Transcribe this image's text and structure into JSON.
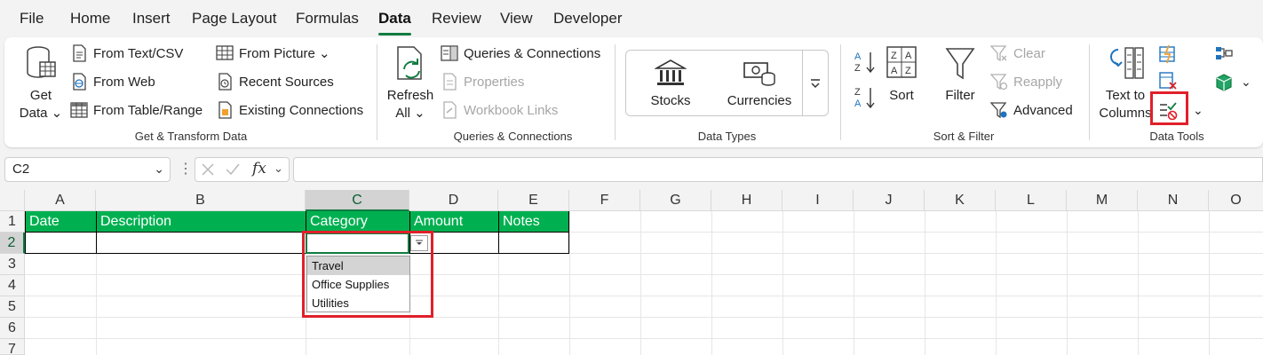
{
  "menu": {
    "tabs": [
      "File",
      "Home",
      "Insert",
      "Page Layout",
      "Formulas",
      "Data",
      "Review",
      "View",
      "Developer"
    ],
    "active": "Data"
  },
  "ribbon": {
    "get_transform": {
      "get_data_line1": "Get",
      "get_data_line2": "Data",
      "from_text_csv": "From Text/CSV",
      "from_web": "From Web",
      "from_table_range": "From Table/Range",
      "from_picture": "From Picture",
      "recent_sources": "Recent Sources",
      "existing_connections": "Existing Connections",
      "label": "Get & Transform Data"
    },
    "queries": {
      "refresh_line1": "Refresh",
      "refresh_line2": "All",
      "queries_connections": "Queries & Connections",
      "properties": "Properties",
      "workbook_links": "Workbook Links",
      "label": "Queries & Connections"
    },
    "data_types": {
      "stocks": "Stocks",
      "currencies": "Currencies",
      "label": "Data Types"
    },
    "sort_filter": {
      "sort": "Sort",
      "filter": "Filter",
      "clear": "Clear",
      "reapply": "Reapply",
      "advanced": "Advanced",
      "label": "Sort & Filter"
    },
    "data_tools": {
      "text_to_line1": "Text to",
      "text_to_line2": "Columns",
      "label": "Data Tools"
    }
  },
  "formula_bar": {
    "name_box": "C2",
    "fx": "fx",
    "formula": ""
  },
  "grid": {
    "columns": [
      "A",
      "B",
      "C",
      "D",
      "E",
      "F",
      "G",
      "H",
      "I",
      "J",
      "K",
      "L",
      "M",
      "N",
      "O"
    ],
    "rows": [
      "1",
      "2",
      "3",
      "4",
      "5",
      "6",
      "7"
    ],
    "headers": [
      "Date",
      "Description",
      "Category",
      "Amount",
      "Notes"
    ],
    "dropdown_options": [
      "Travel",
      "Office Supplies",
      "Utilities"
    ]
  },
  "colors": {
    "header_green": "#00b050",
    "accent_green": "#107c41",
    "highlight_red": "#e0202a"
  }
}
